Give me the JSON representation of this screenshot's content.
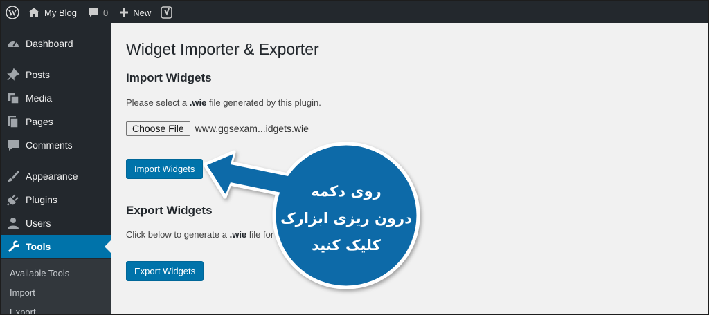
{
  "adminbar": {
    "site_name": "My Blog",
    "comment_count": "0",
    "new_label": "New"
  },
  "sidebar": {
    "items": [
      {
        "label": "Dashboard",
        "icon": "dashboard-icon"
      },
      {
        "label": "Posts",
        "icon": "pin-icon"
      },
      {
        "label": "Media",
        "icon": "media-icon"
      },
      {
        "label": "Pages",
        "icon": "pages-icon"
      },
      {
        "label": "Comments",
        "icon": "comment-icon"
      },
      {
        "label": "Appearance",
        "icon": "paintbrush-icon"
      },
      {
        "label": "Plugins",
        "icon": "plugin-icon"
      },
      {
        "label": "Users",
        "icon": "user-icon"
      },
      {
        "label": "Tools",
        "icon": "wrench-icon"
      }
    ],
    "submenu": [
      "Available Tools",
      "Import",
      "Export"
    ]
  },
  "main": {
    "page_title": "Widget Importer & Exporter",
    "import": {
      "title": "Import Widgets",
      "desc_before": "Please select a ",
      "desc_ext": ".wie",
      "desc_after": " file generated by this plugin.",
      "choose_label": "Choose File",
      "file_name": "www.ggsexam...idgets.wie",
      "button_label": "Import Widgets"
    },
    "export": {
      "title": "Export Widgets",
      "desc_before": "Click below to generate a ",
      "desc_ext": ".wie",
      "desc_after": " file for",
      "button_label": "Export Widgets"
    }
  },
  "annotation": {
    "lines": [
      "روی دکمه",
      "درون ریزی ابزارک",
      "کلیک کنید"
    ],
    "color": "#0f6ba8"
  }
}
